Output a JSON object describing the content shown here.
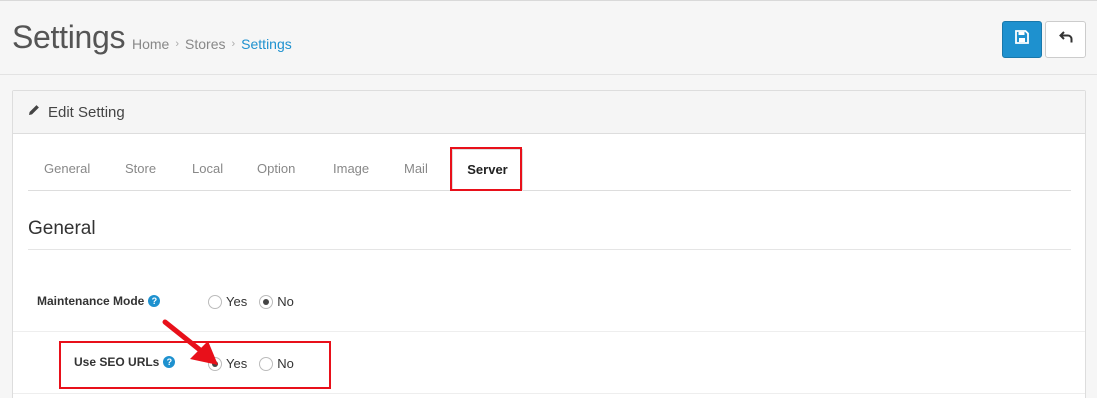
{
  "header": {
    "title": "Settings",
    "breadcrumb": [
      "Home",
      "Stores",
      "Settings"
    ]
  },
  "toolbar": {
    "save_icon": "save-icon",
    "back_icon": "back-icon",
    "save_color": "#1e91cf"
  },
  "panel": {
    "heading": "Edit Setting",
    "heading_icon": "pencil-icon"
  },
  "tabs": [
    {
      "label": "General"
    },
    {
      "label": "Store"
    },
    {
      "label": "Local"
    },
    {
      "label": "Option"
    },
    {
      "label": "Image"
    },
    {
      "label": "Mail"
    },
    {
      "label": "Server",
      "active": true
    }
  ],
  "section": {
    "title": "General"
  },
  "fields": {
    "maintenance": {
      "label": "Maintenance Mode",
      "yes": "Yes",
      "no": "No",
      "selected": "No"
    },
    "seo": {
      "label": "Use SEO URLs",
      "yes": "Yes",
      "no": "No",
      "selected": "Yes"
    }
  },
  "annotations": {
    "highlight_color": "#e8101a"
  }
}
